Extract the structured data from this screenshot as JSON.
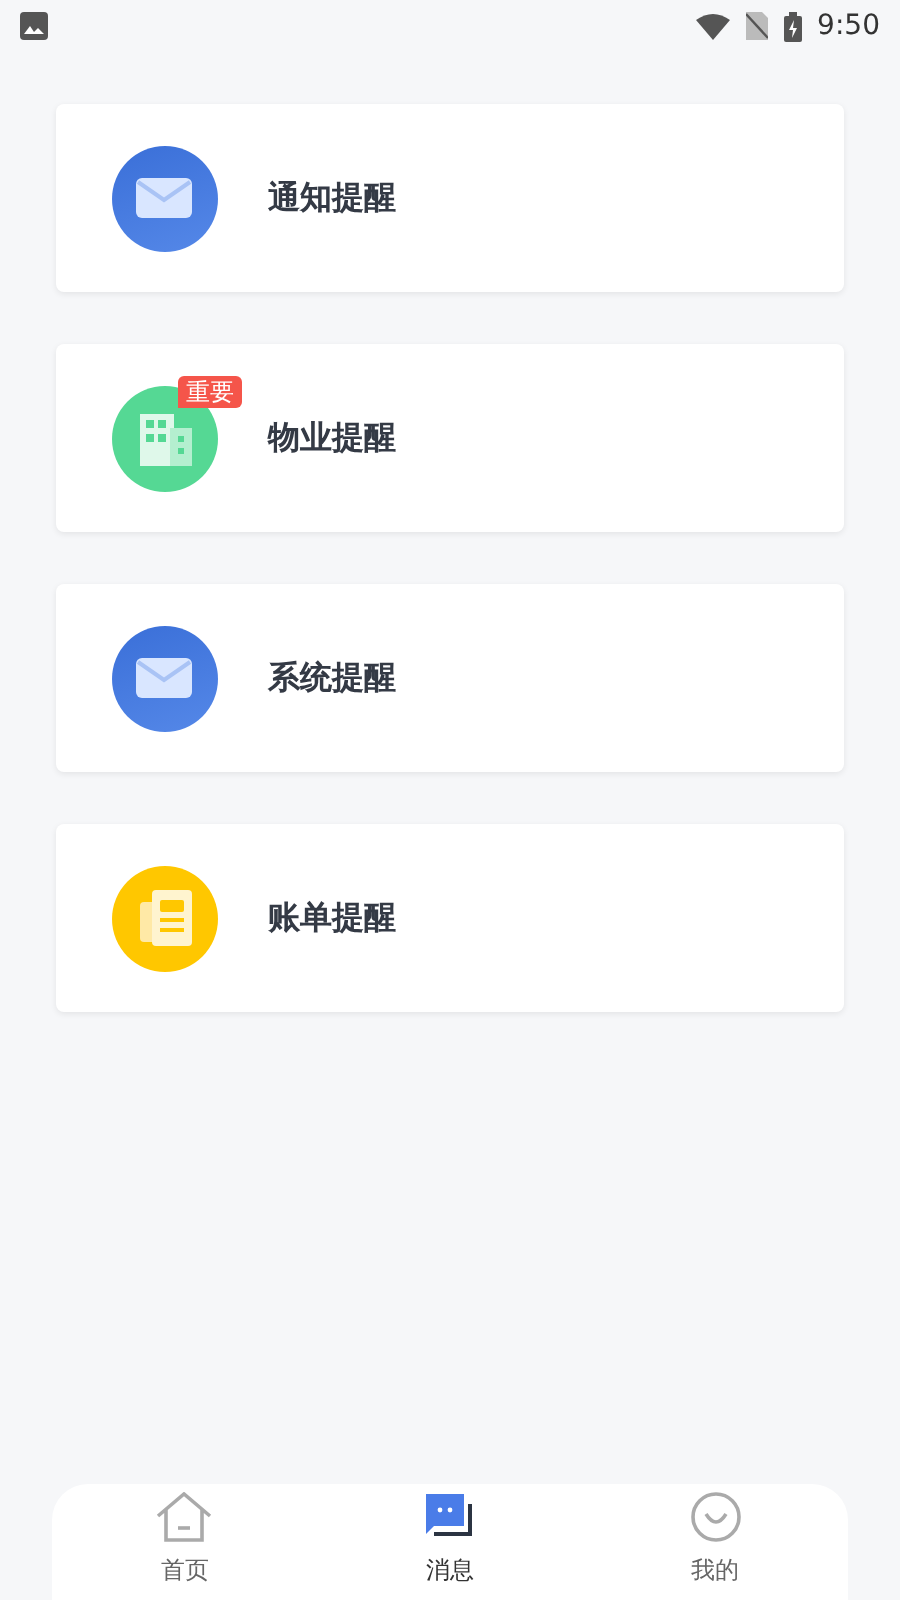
{
  "status_bar": {
    "time": "9:50"
  },
  "items": [
    {
      "kind": "mail",
      "label": "通知提醒"
    },
    {
      "kind": "building",
      "label": "物业提醒",
      "badge": "重要"
    },
    {
      "kind": "mail",
      "label": "系统提醒"
    },
    {
      "kind": "bill",
      "label": "账单提醒"
    }
  ],
  "tabs": [
    {
      "kind": "home",
      "label": "首页",
      "selected": false
    },
    {
      "kind": "message",
      "label": "消息",
      "selected": true
    },
    {
      "kind": "me",
      "label": "我的",
      "selected": false
    }
  ]
}
